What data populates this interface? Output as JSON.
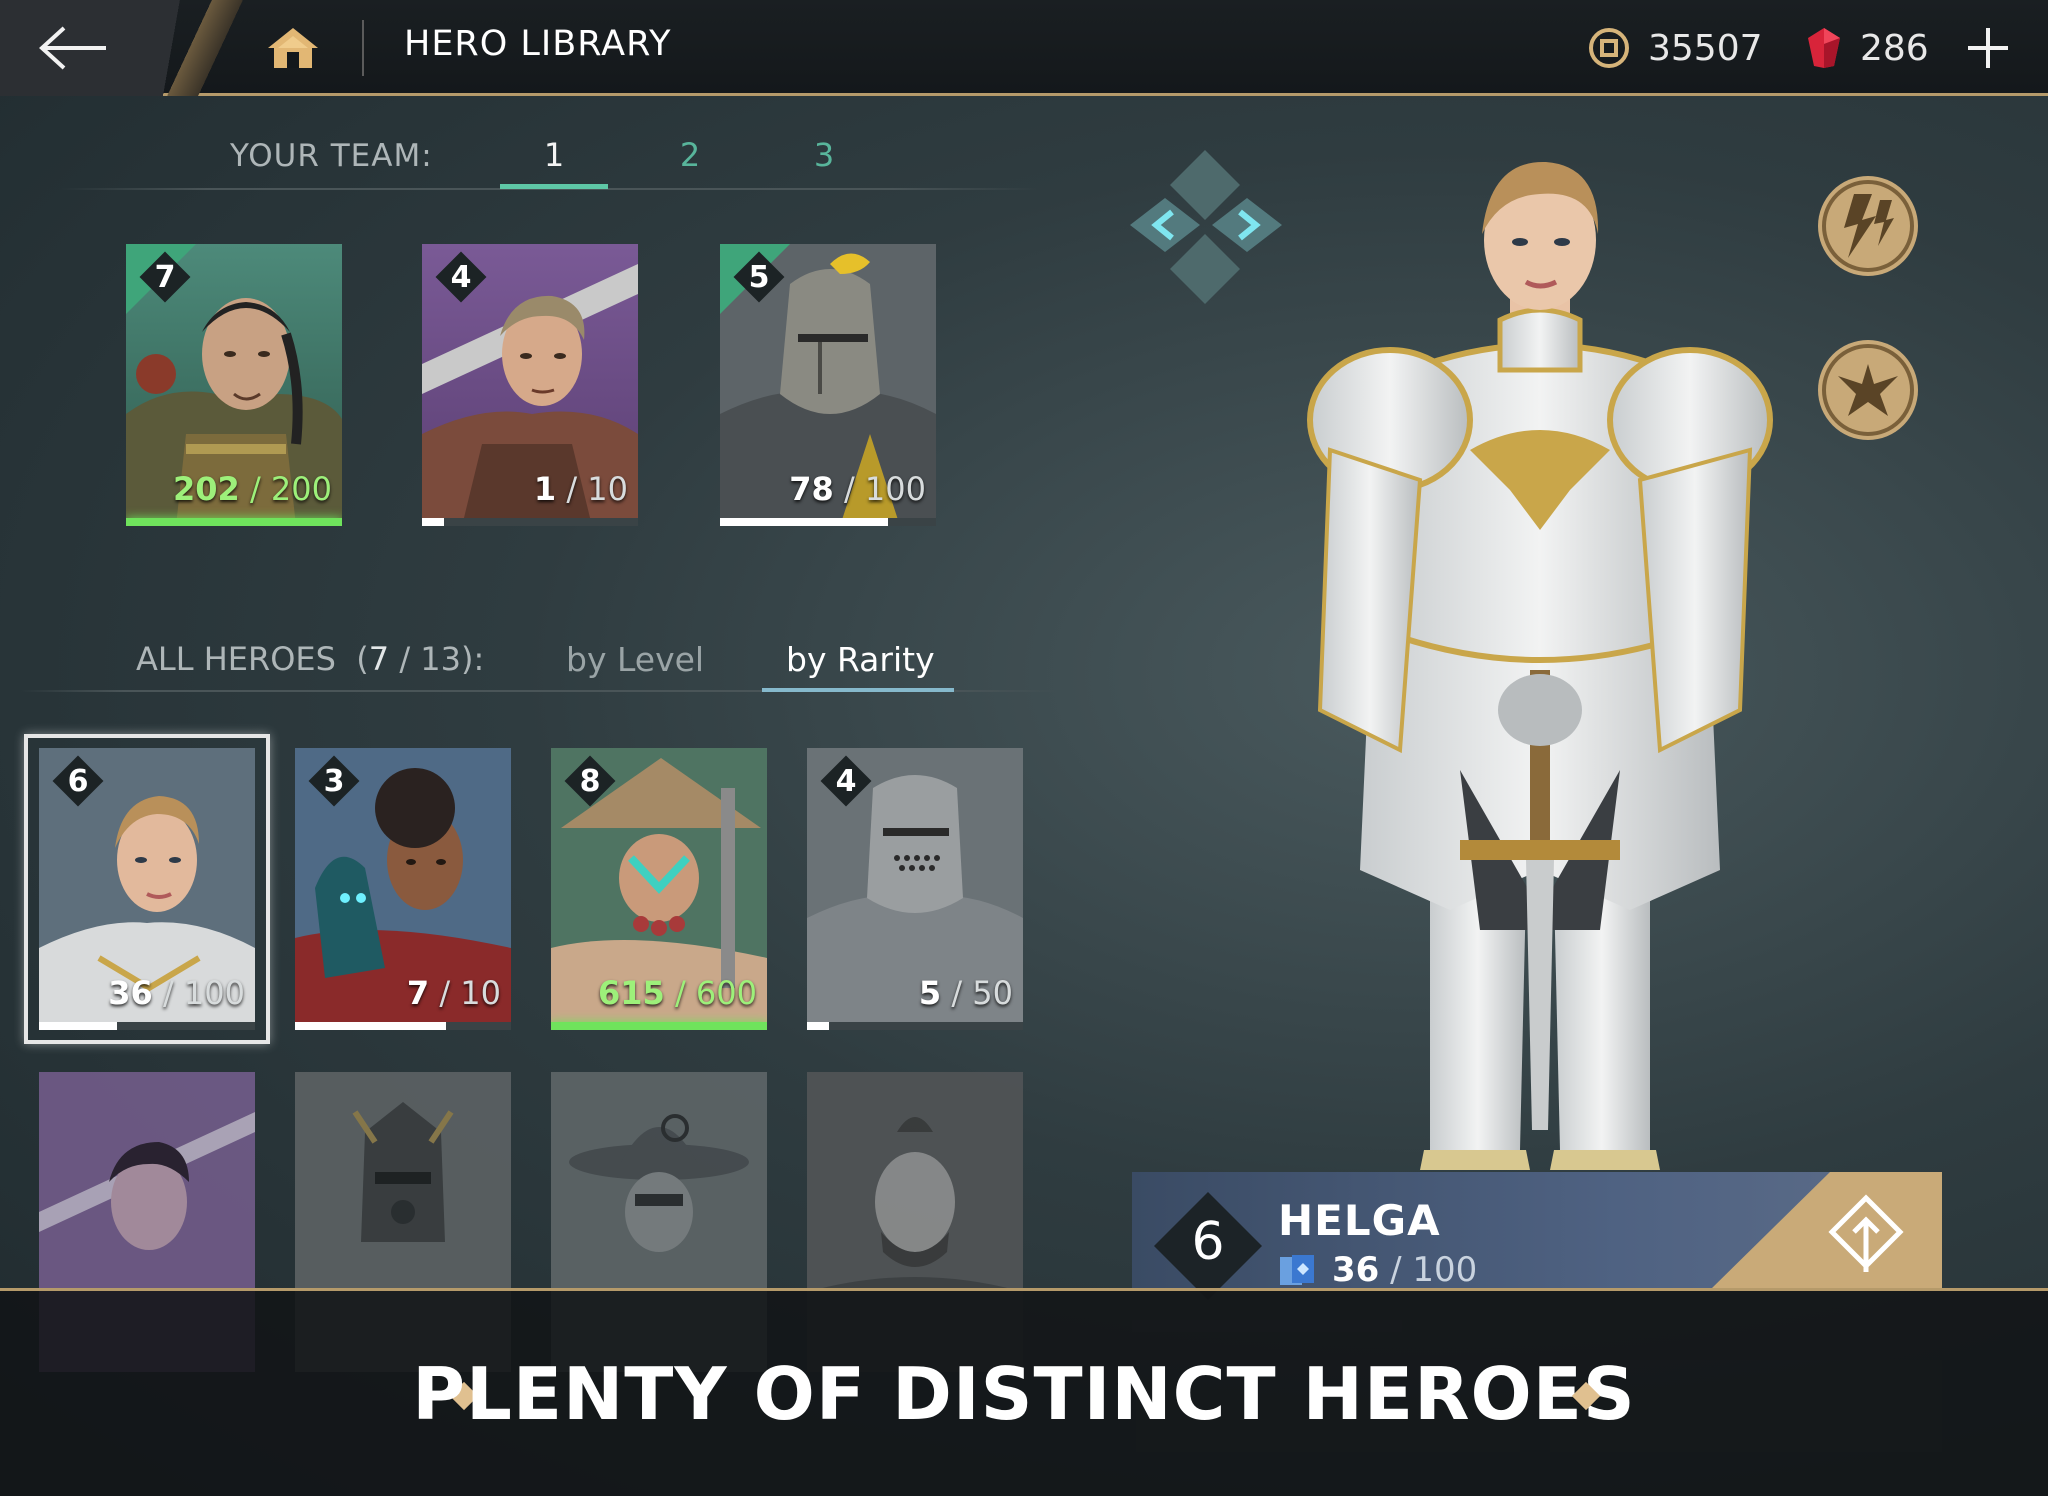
{
  "header": {
    "title": "HERO LIBRARY",
    "coins": "35507",
    "gems": "286"
  },
  "team": {
    "label": "YOUR TEAM:",
    "tabs": [
      "1",
      "2",
      "3"
    ],
    "active_tab": "1",
    "cards": [
      {
        "rank": "7",
        "current": "202",
        "max": "200",
        "progress": 1.0,
        "full": true
      },
      {
        "rank": "4",
        "current": "1",
        "max": "10",
        "progress": 0.1,
        "full": false
      },
      {
        "rank": "5",
        "current": "78",
        "max": "100",
        "progress": 0.78,
        "full": false
      }
    ]
  },
  "library": {
    "label": "ALL HEROES",
    "count_owned": "7",
    "count_total": "13",
    "sort_level": "by Level",
    "sort_rarity": "by Rarity",
    "active_sort": "by Rarity",
    "cards": [
      {
        "rank": "6",
        "current": "36",
        "max": "100",
        "progress": 0.36,
        "full": false,
        "selected": true
      },
      {
        "rank": "3",
        "current": "7",
        "max": "10",
        "progress": 0.7,
        "full": false
      },
      {
        "rank": "8",
        "current": "615",
        "max": "600",
        "progress": 1.0,
        "full": true
      },
      {
        "rank": "4",
        "current": "5",
        "max": "50",
        "progress": 0.1,
        "full": false
      }
    ]
  },
  "selected_hero": {
    "name": "HELGA",
    "level": "6",
    "cards_current": "36",
    "cards_max": "100"
  },
  "banner": {
    "tagline": "PLENTY OF DISTINCT HEROES"
  },
  "colors": {
    "accent_gold": "#b59a6a",
    "team_tab_active": "#5ec7a6",
    "progress_full": "#6fe35c",
    "gem_red": "#d8243a"
  }
}
